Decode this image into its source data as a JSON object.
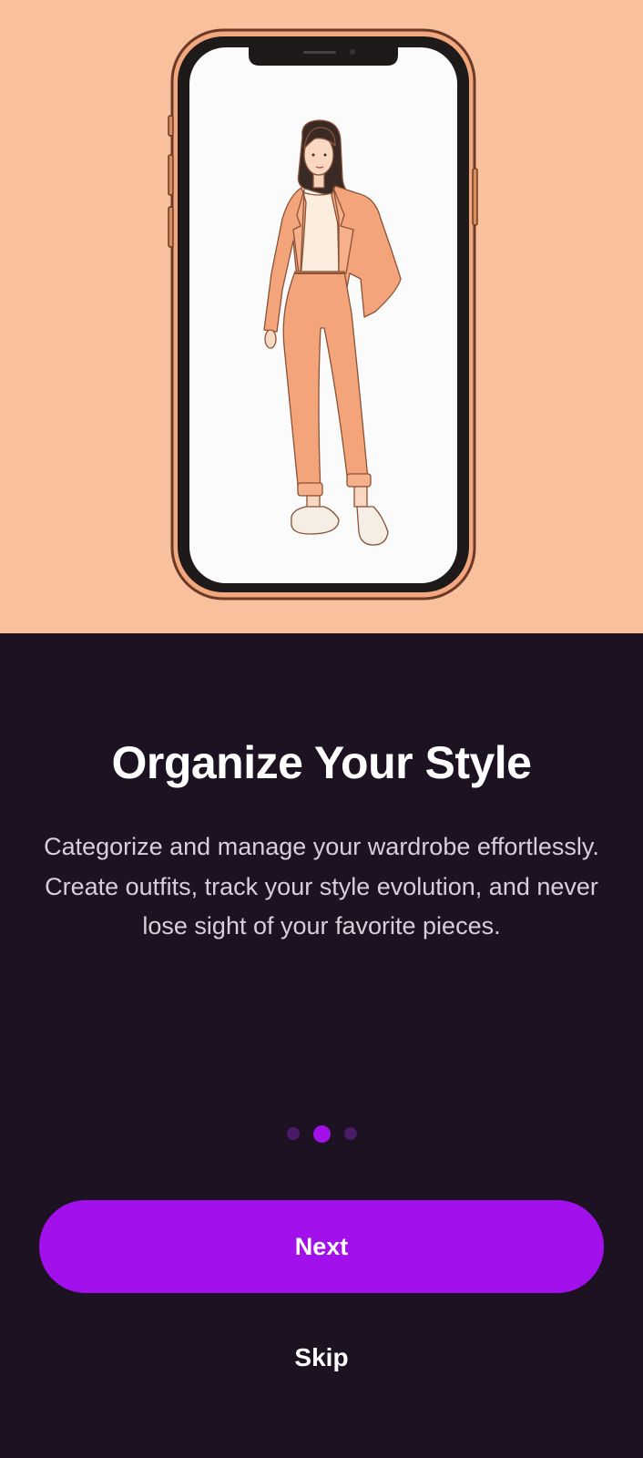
{
  "onboarding": {
    "title": "Organize Your Style",
    "description": "Categorize and manage your wardrobe effortlessly. Create outfits, track your style evolution, and never lose sight of your favorite pieces.",
    "pagination": {
      "total": 3,
      "current": 2
    },
    "next_label": "Next",
    "skip_label": "Skip"
  },
  "hero": {
    "illustration": "phone-with-woman-in-peach-suit-illustration"
  },
  "colors": {
    "hero_background": "#f9c09e",
    "page_background": "#1c1222",
    "accent": "#a211eb",
    "dot_inactive": "#4a1a66"
  }
}
